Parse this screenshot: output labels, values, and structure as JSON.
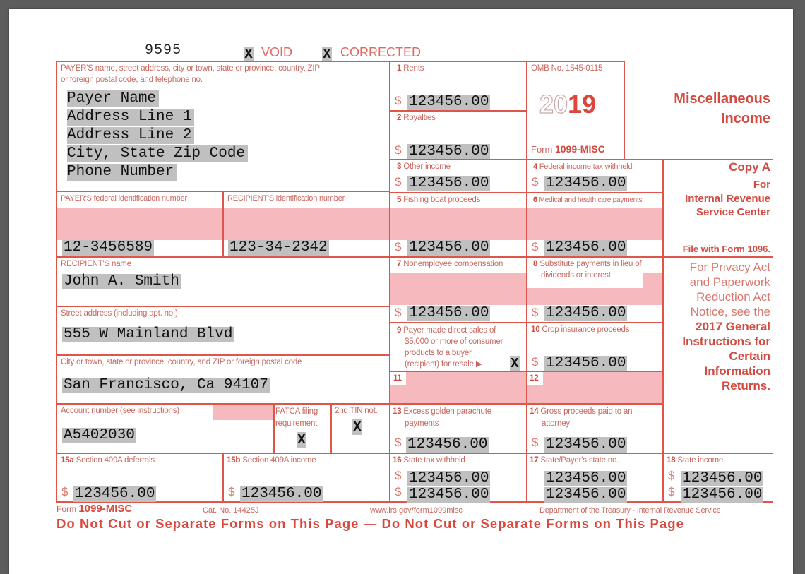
{
  "header": {
    "form_code": "9595",
    "void_mark": "X",
    "void_label": "VOID",
    "corrected_mark": "X",
    "corrected_label": "CORRECTED"
  },
  "payer": {
    "label": "PAYER'S name, street address, city or town, state or province, country, ZIP or foreign postal code, and telephone no.",
    "label_line1": "PAYER'S name, street address, city or town, state or province, country, ZIP",
    "label_line2": "or foreign postal code, and telephone no.",
    "lines": [
      "Payer Name",
      "Address Line 1",
      "Address Line 2",
      "City, State Zip Code",
      "Phone Number"
    ]
  },
  "omb": {
    "omb_number": "OMB No. 1545-0115",
    "year_outline": "20",
    "year_bold": "19",
    "form_prefix": "Form",
    "form_name": "1099-MISC"
  },
  "title": {
    "line1": "Miscellaneous",
    "line2": "Income"
  },
  "copy": {
    "copy_label": "Copy A",
    "for": "For",
    "irs_line1": "Internal Revenue",
    "irs_line2": "Service Center",
    "file_with": "File with Form 1096."
  },
  "privacy": {
    "lines_regular": [
      "For Privacy Act",
      "and Paperwork",
      "Reduction Act",
      "Notice, see the"
    ],
    "lines_bold": [
      "2017 General",
      "Instructions for",
      "Certain",
      "Information",
      "Returns."
    ]
  },
  "ids": {
    "payer_tin_label": "PAYER'S federal identification number",
    "payer_tin": "12-3456589",
    "recipient_tin_label": "RECIPIENT'S identification number",
    "recipient_tin": "123-34-2342"
  },
  "recipient": {
    "name_label": "RECIPIENT'S name",
    "name": "John A. Smith",
    "street_label": "Street address (including apt. no.)",
    "street": "555 W Mainland Blvd",
    "city_label": "City or town, state or province, country, and ZIP or foreign postal code",
    "city": "San Francisco, Ca 94107"
  },
  "account": {
    "label": "Account number (see instructions)",
    "value": "A5402030",
    "fatca_label_1": "FATCA filing",
    "fatca_label_2": "requirement",
    "fatca_mark": "X",
    "tin2_label": "2nd TIN not.",
    "tin2_mark": "X"
  },
  "currency_symbol": "$",
  "boxes": {
    "b1": {
      "num": "1",
      "label": "Rents",
      "value": "123456.00"
    },
    "b2": {
      "num": "2",
      "label": "Royalties",
      "value": "123456.00"
    },
    "b3": {
      "num": "3",
      "label": "Other income",
      "value": "123456.00"
    },
    "b4": {
      "num": "4",
      "label": "Federal income tax withheld",
      "value": "123456.00"
    },
    "b5": {
      "num": "5",
      "label": "Fishing boat proceeds",
      "value": "123456.00"
    },
    "b6": {
      "num": "6",
      "label": "Medical and health care payments",
      "value": "123456.00"
    },
    "b7": {
      "num": "7",
      "label": "Nonemployee compensation",
      "value": "123456.00"
    },
    "b8": {
      "num": "8",
      "label_1": "Substitute payments in lieu of",
      "label_2": "dividends or interest",
      "value": "123456.00"
    },
    "b9": {
      "num": "9",
      "label_1": "Payer made direct sales of",
      "label_2": "$5,000 or more of consumer",
      "label_3": "products to a buyer",
      "label_4": "(recipient) for resale ▶",
      "mark": "X"
    },
    "b10": {
      "num": "10",
      "label": "Crop insurance proceeds",
      "value": "123456.00"
    },
    "b11": {
      "num": "11"
    },
    "b12": {
      "num": "12"
    },
    "b13": {
      "num": "13",
      "label_1": "Excess golden parachute",
      "label_2": "payments",
      "value": "123456.00"
    },
    "b14": {
      "num": "14",
      "label_1": "Gross proceeds paid to an",
      "label_2": "attorney",
      "value": "123456.00"
    },
    "b15a": {
      "num": "15a",
      "label": "Section 409A deferrals",
      "value": "123456.00"
    },
    "b15b": {
      "num": "15b",
      "label": "Section 409A income",
      "value": "123456.00"
    },
    "b16": {
      "num": "16",
      "label": "State tax withheld",
      "value_1": "123456.00",
      "value_2": "123456.00"
    },
    "b17": {
      "num": "17",
      "label": "State/Payer's state no.",
      "value_1": "123456.00",
      "value_2": "123456.00"
    },
    "b18": {
      "num": "18",
      "label": "State income",
      "value_1": "123456.00",
      "value_2": "123456.00"
    }
  },
  "footer": {
    "form_prefix": "Form",
    "form_name": "1099-MISC",
    "cat_no": "Cat. No. 14425J",
    "url": "www.irs.gov/form1099misc",
    "department": "Department of the Treasury - Internal Revenue Service",
    "warning": "Do Not Cut or Separate Forms on This Page — Do Not Cut or Separate Forms on This Page"
  },
  "colors": {
    "form_red": "#e0554a",
    "pink_fill": "#f6b9bd",
    "value_highlight": "#c0c0c0",
    "background": "#5d5d5d"
  }
}
